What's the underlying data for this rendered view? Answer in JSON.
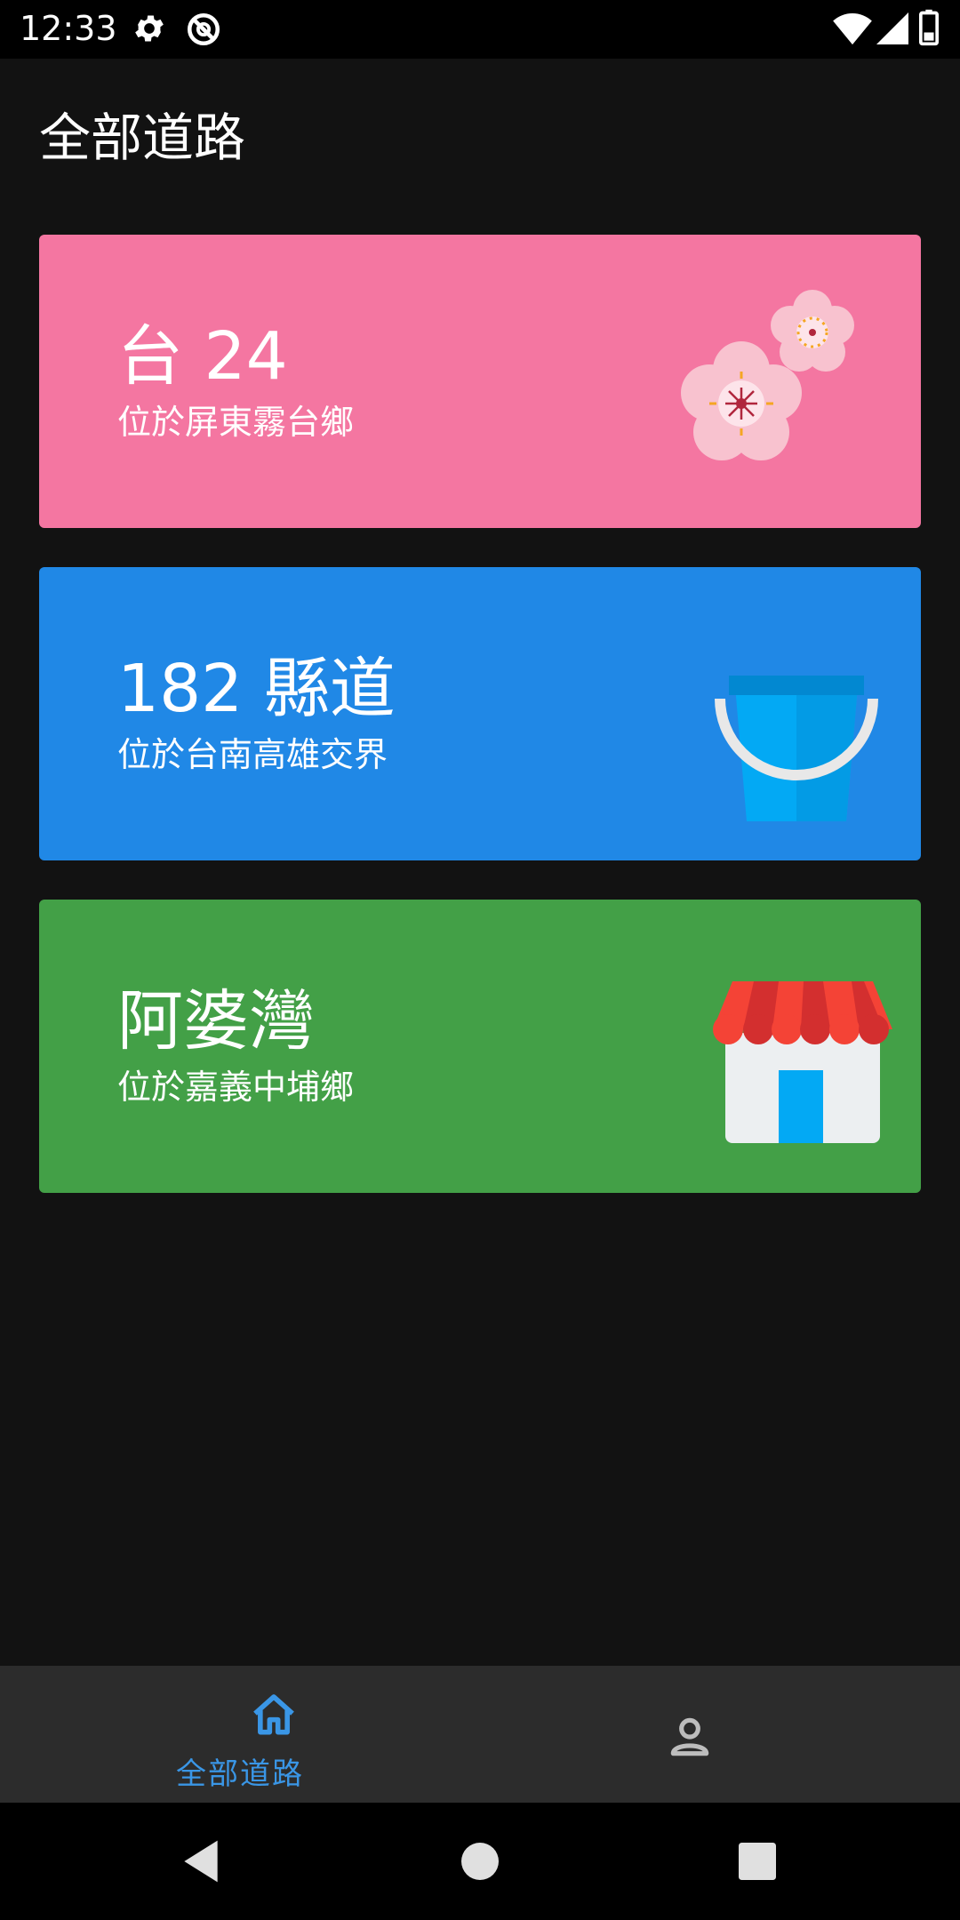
{
  "status_bar": {
    "time": "12:33",
    "icons": [
      "gear-icon",
      "do-not-disturb-icon",
      "wifi-icon",
      "signal-icon",
      "battery-icon"
    ]
  },
  "page": {
    "title": "全部道路"
  },
  "cards": [
    {
      "title": "台 24",
      "subtitle": "位於屏東霧台鄉",
      "color": "#f476a1",
      "icon": "cherry-blossom-icon"
    },
    {
      "title": "182 縣道",
      "subtitle": "位於台南高雄交界",
      "color": "#2088e6",
      "icon": "bucket-icon"
    },
    {
      "title": "阿婆灣",
      "subtitle": "位於嘉義中埔鄉",
      "color": "#43a047",
      "icon": "store-icon"
    }
  ],
  "bottom_nav": {
    "home_label": "全部道路",
    "active_color": "#3a96e6",
    "inactive_color": "#bdbdbd",
    "items": [
      "home-icon",
      "person-icon"
    ]
  },
  "system_nav": [
    "back-icon",
    "home-circle-icon",
    "recents-icon"
  ]
}
